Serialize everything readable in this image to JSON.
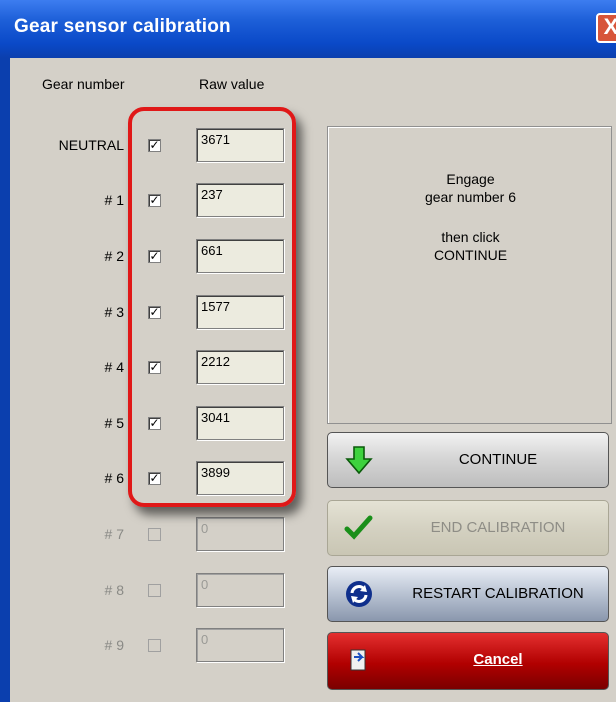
{
  "window": {
    "title": "Gear sensor calibration",
    "close_glyph": "X"
  },
  "headers": {
    "gear_number": "Gear number",
    "raw_value": "Raw value"
  },
  "gears": [
    {
      "label": "NEUTRAL",
      "checked": true,
      "value": "3671"
    },
    {
      "label": "# 1",
      "checked": true,
      "value": "237"
    },
    {
      "label": "# 2",
      "checked": true,
      "value": "661"
    },
    {
      "label": "# 3",
      "checked": true,
      "value": "1577"
    },
    {
      "label": "# 4",
      "checked": true,
      "value": "2212"
    },
    {
      "label": "# 5",
      "checked": true,
      "value": "3041"
    },
    {
      "label": "# 6",
      "checked": true,
      "value": "3899"
    },
    {
      "label": "# 7",
      "checked": false,
      "value": "0"
    },
    {
      "label": "# 8",
      "checked": false,
      "value": "0"
    },
    {
      "label": "# 9",
      "checked": false,
      "value": "0"
    }
  ],
  "message": {
    "line1": "Engage",
    "line2": "gear number 6",
    "line3": "then click",
    "line4": "CONTINUE"
  },
  "buttons": {
    "continue": "CONTINUE",
    "end_calibration": "END CALIBRATION",
    "restart_calibration": "RESTART CALIBRATION",
    "cancel": "Cancel"
  },
  "icons": {
    "continue": "green-down-arrow-icon",
    "end_calibration": "green-check-icon",
    "restart_calibration": "blue-refresh-icon",
    "cancel": "exit-door-icon"
  },
  "colors": {
    "highlight": "#e01818",
    "title_bar": "#0a49c8",
    "cancel": "#b10000"
  }
}
